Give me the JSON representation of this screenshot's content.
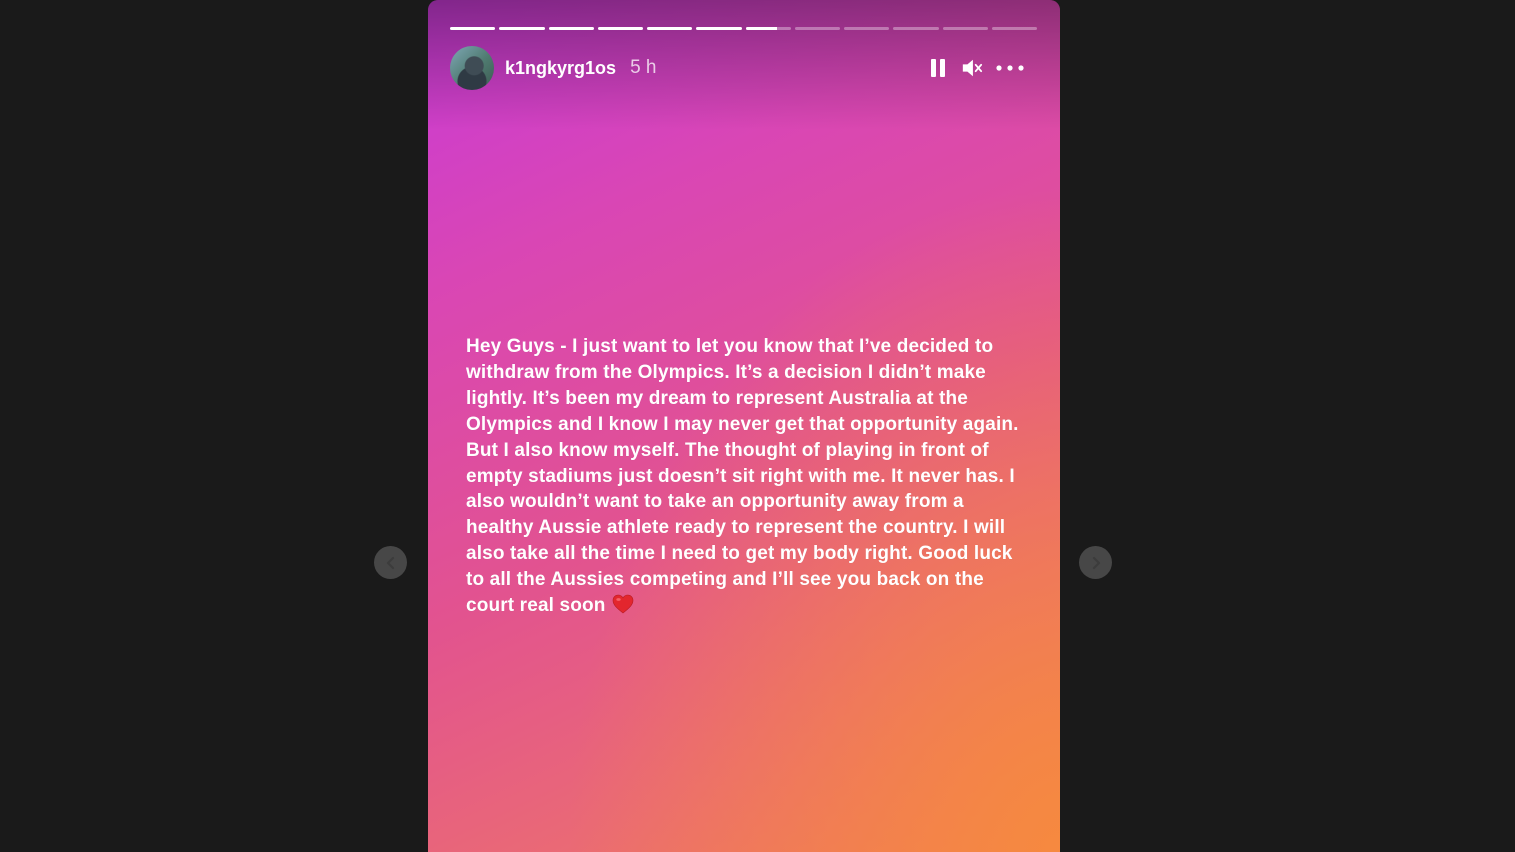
{
  "story": {
    "username": "k1ngkyrg1os",
    "time_ago": "5 h",
    "message": "Hey Guys - I just want to let you know that I’ve decided to withdraw from the Olympics. It’s a decision I didn’t make lightly. It’s been my dream to represent Australia at the Olympics and I know I may never get that opportunity again. But I also know myself. The thought of playing in front of empty stadiums just doesn’t sit right with me. It never has. I also wouldn’t want to take an opportunity away from a healthy Aussie athlete ready to represent the country. I will also take all the time I need to get my body right. Good luck to all the Aussies competing and I’ll see you back on the court real soon",
    "emoji": "heart-emoji",
    "progress": {
      "segments_total": 12,
      "current_segment_index": 6,
      "current_segment_fill": 0.7
    },
    "gradient_colors": [
      "#c83ad7",
      "#e2538f",
      "#f07b58"
    ]
  },
  "controls": {
    "pause_icon": "pause-icon",
    "mute_icon": "speaker-muted-icon",
    "more_icon": "more-options-icon"
  },
  "navigation": {
    "prev_icon": "chevron-left-icon",
    "next_icon": "chevron-right-icon"
  }
}
